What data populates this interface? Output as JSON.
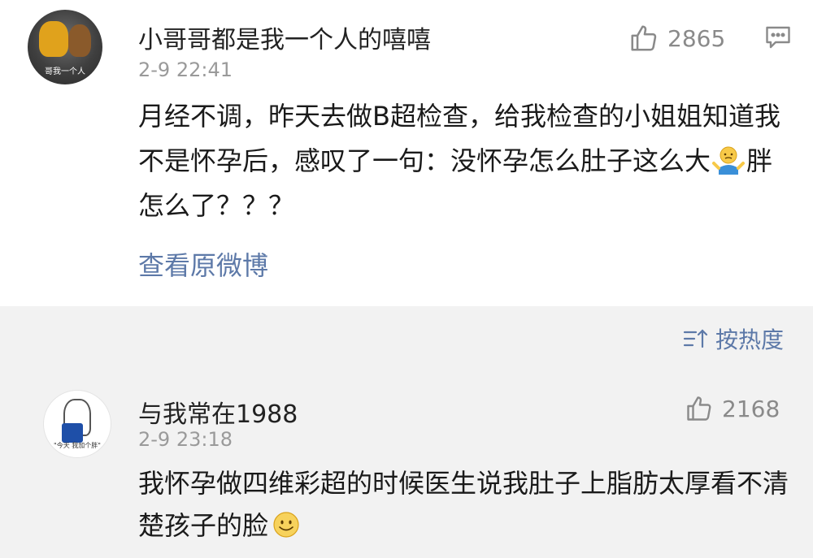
{
  "post": {
    "author": "小哥哥都是我一个人的嘻嘻",
    "avatar_caption": "哥我一个人",
    "time": "2-9 22:41",
    "likes": "2865",
    "body_part1": "月经不调，昨天去做B超检查，给我检查的小姐姐知道我不是怀孕后，感叹了一句：没怀孕怎么肚子这么大",
    "body_part2": "胖怎么了？？？",
    "emoji_icon": "shrug-emoji-icon",
    "view_original": "查看原微博"
  },
  "sort": {
    "label": "按热度",
    "icon": "sort-icon"
  },
  "comment": {
    "author": "与我常在1988",
    "avatar_caption": "\"今天 我加个胖\"",
    "time": "2-9 23:18",
    "likes": "2168",
    "body": "我怀孕做四维彩超的时候医生说我肚子上脂肪太厚看不清楚孩子的脸",
    "emoji_icon": "smile-emoji-icon"
  },
  "colors": {
    "link": "#5d79a8",
    "muted": "#9a9a9a",
    "section_bg": "#f2f2f2"
  }
}
